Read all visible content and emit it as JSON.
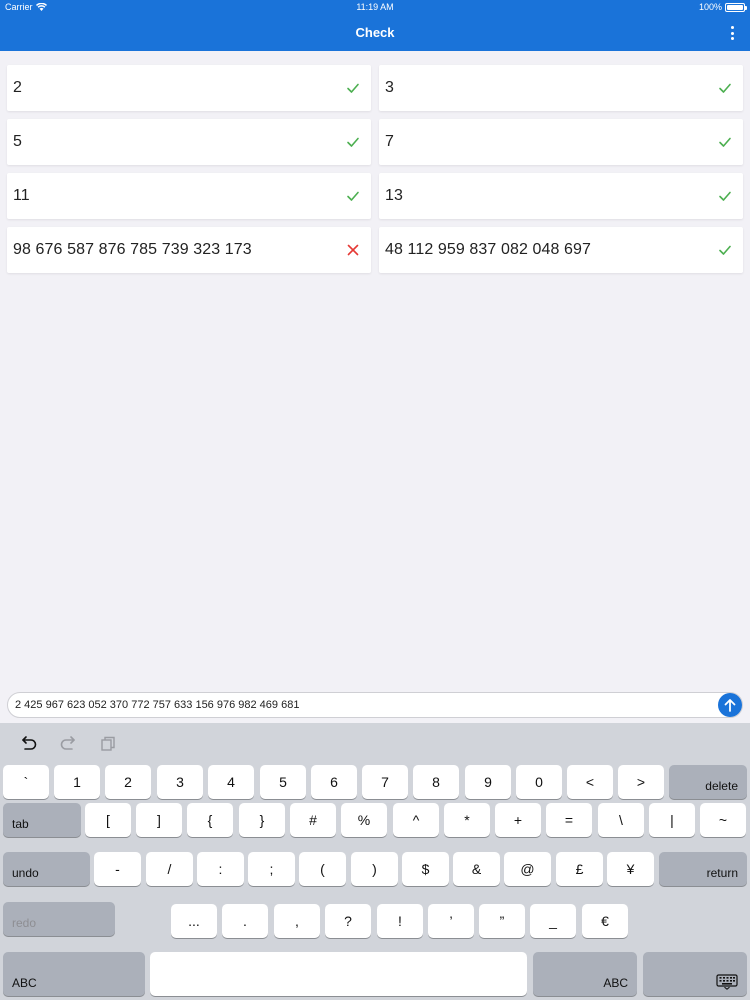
{
  "status_bar": {
    "carrier": "Carrier",
    "time": "11:19 AM",
    "battery": "100%",
    "battery_level": 1.0
  },
  "nav": {
    "title": "Check",
    "menu_icon": "more-vertical-icon"
  },
  "colors": {
    "accent": "#1a73d9",
    "valid": "#4caf50",
    "invalid": "#e53935"
  },
  "results": [
    {
      "value": "2",
      "status": "valid"
    },
    {
      "value": "3",
      "status": "valid"
    },
    {
      "value": "5",
      "status": "valid"
    },
    {
      "value": "7",
      "status": "valid"
    },
    {
      "value": "11",
      "status": "valid"
    },
    {
      "value": "13",
      "status": "valid"
    },
    {
      "value": "98 676 587 876 785 739 323 173",
      "status": "invalid"
    },
    {
      "value": "48 112 959 837 082 048 697",
      "status": "valid"
    }
  ],
  "input": {
    "value": "2 425 967 623 052 370 772 757 633 156 976 982 469 681"
  },
  "keyboard": {
    "toolbar": [
      "undo-icon",
      "redo-icon",
      "paste-icon"
    ],
    "row1": [
      "`",
      "1",
      "2",
      "3",
      "4",
      "5",
      "6",
      "7",
      "8",
      "9",
      "0",
      "<",
      ">"
    ],
    "delete": "delete",
    "tab": "tab",
    "row2": [
      "[",
      "]",
      "{",
      "}",
      "#",
      "%",
      "^",
      "*",
      "+",
      "=",
      "\\",
      "|",
      "~"
    ],
    "undo": "undo",
    "row3": [
      "-",
      "/",
      ":",
      ";",
      "(",
      ")",
      "$",
      "&",
      "@",
      "£",
      "¥"
    ],
    "return": "return",
    "redo": "redo",
    "row4": [
      "...",
      ".",
      ",",
      "?",
      "!",
      "’",
      "”",
      "_",
      "€"
    ],
    "abc_left": "ABC",
    "abc_right": "ABC",
    "dismiss_icon": "keyboard-dismiss-icon"
  }
}
